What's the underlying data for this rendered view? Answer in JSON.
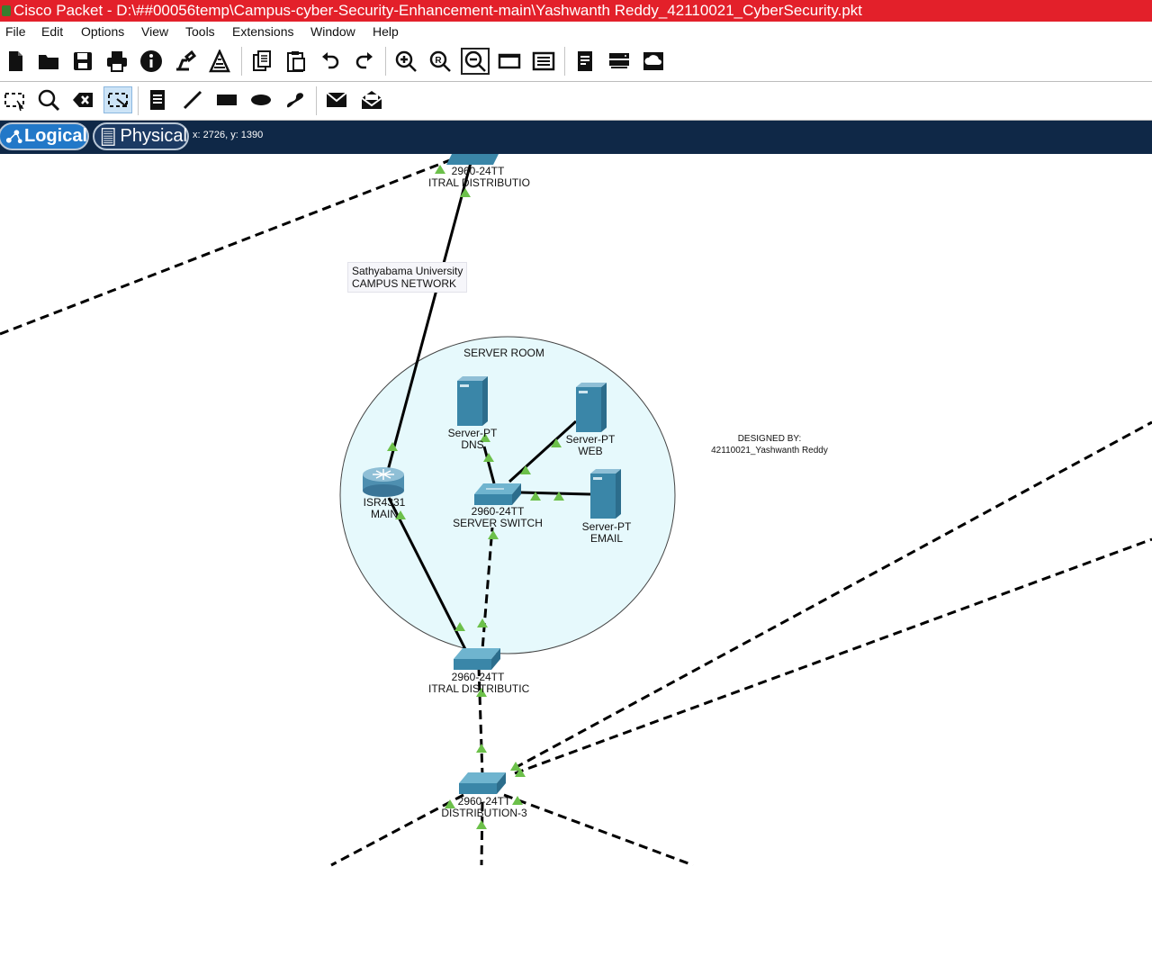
{
  "window": {
    "title": "Cisco Packet - D:\\##00056temp\\Campus-cyber-Security-Enhancement-main\\Yashwanth Reddy_42110021_CyberSecurity.pkt"
  },
  "menu": [
    "File",
    "Edit",
    "Options",
    "View",
    "Tools",
    "Extensions",
    "Window",
    "Help"
  ],
  "toolbar_main": [
    {
      "icon": "new-file-icon"
    },
    {
      "icon": "open-folder-icon"
    },
    {
      "icon": "save-icon"
    },
    {
      "icon": "print-icon"
    },
    {
      "icon": "info-icon"
    },
    {
      "icon": "activity-wizard-icon"
    },
    {
      "icon": "network-info-icon"
    },
    {
      "icon": "copy-icon"
    },
    {
      "icon": "paste-icon"
    },
    {
      "icon": "undo-icon"
    },
    {
      "icon": "redo-icon"
    },
    {
      "icon": "zoom-in-icon"
    },
    {
      "icon": "zoom-reset-icon"
    },
    {
      "icon": "zoom-out-icon"
    },
    {
      "icon": "drawing-palette-icon"
    },
    {
      "icon": "custom-devices-icon"
    },
    {
      "icon": "pdu-list-icon"
    },
    {
      "icon": "device-template-icon"
    },
    {
      "icon": "cloud-icon"
    }
  ],
  "toolbar_edit": [
    {
      "icon": "select-icon"
    },
    {
      "icon": "inspect-icon"
    },
    {
      "icon": "delete-icon"
    },
    {
      "icon": "resize-shape-icon"
    },
    {
      "icon": "place-note-icon"
    },
    {
      "icon": "draw-line-icon"
    },
    {
      "icon": "draw-rectangle-icon"
    },
    {
      "icon": "draw-ellipse-icon"
    },
    {
      "icon": "freeform-icon"
    },
    {
      "icon": "add-simple-pdu-icon"
    },
    {
      "icon": "add-complex-pdu-icon"
    }
  ],
  "nav": {
    "logical": "Logical",
    "physical": "Physical",
    "coords": "x: 2726, y: 1390"
  },
  "canvas": {
    "campus_label": [
      "Sathyabama University",
      "CAMPUS NETWORK"
    ],
    "server_room_label": "SERVER ROOM",
    "designed_by": [
      "DESIGNED BY:",
      "42110021_Yashwanth Reddy"
    ],
    "devices": [
      {
        "id": "top-switch",
        "model": "2960-24TT",
        "name": "ITRAL DISTRIBUTIO"
      },
      {
        "id": "router",
        "model": "ISR4331",
        "name": "MAIN"
      },
      {
        "id": "server-switch",
        "model": "2960-24TT",
        "name": "SERVER SWITCH"
      },
      {
        "id": "dns-server",
        "model": "Server-PT",
        "name": "DNS"
      },
      {
        "id": "web-server",
        "model": "Server-PT",
        "name": "WEB"
      },
      {
        "id": "email-server",
        "model": "Server-PT",
        "name": "EMAIL"
      },
      {
        "id": "central-switch",
        "model": "2960-24TT",
        "name": "ITRAL DISTRIBUTIC"
      },
      {
        "id": "distribution-3",
        "model": "2960-24TT",
        "name": "DISTRIBUTION-3"
      }
    ],
    "colors": {
      "link": "#000000",
      "link_up": "#6cc04a",
      "server_room_fill": "#e6f9fc",
      "device": "#3a86a8"
    }
  }
}
